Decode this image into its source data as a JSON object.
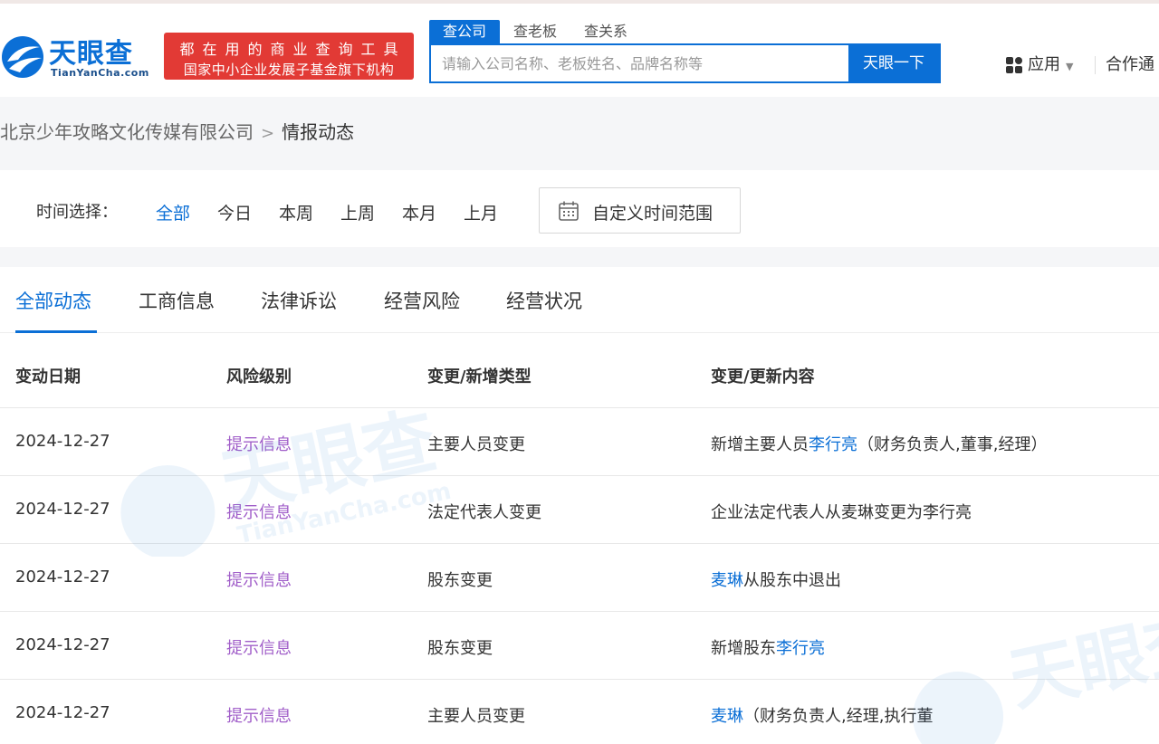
{
  "header": {
    "logo_cn": "天眼查",
    "logo_en": "TianYanCha.com",
    "slogan_line1": "都在用的商业查询工具",
    "slogan_line2": "国家中小企业发展子基金旗下机构",
    "search_tabs": [
      "查公司",
      "查老板",
      "查关系"
    ],
    "search_placeholder": "请输入公司名称、老板姓名、品牌名称等",
    "search_button": "天眼一下",
    "apps_label": "应用",
    "coop_label": "合作通"
  },
  "breadcrumb": {
    "company": "北京少年攻略文化传媒有限公司",
    "separator": ">",
    "current": "情报动态"
  },
  "filter": {
    "label": "时间选择：",
    "options": [
      "全部",
      "今日",
      "本周",
      "上周",
      "本月",
      "上月"
    ],
    "active": "全部",
    "custom_label": "自定义时间范围"
  },
  "tabs": {
    "items": [
      "全部动态",
      "工商信息",
      "法律诉讼",
      "经营风险",
      "经营状况"
    ],
    "active": "全部动态"
  },
  "table": {
    "headers": [
      "变动日期",
      "风险级别",
      "变更/新增类型",
      "变更/更新内容"
    ],
    "rows": [
      {
        "date": "2024-12-27",
        "risk": "提示信息",
        "type": "主要人员变更",
        "content_pre": "新增主要人员",
        "content_link": "李行亮",
        "content_post": "（财务负责人,董事,经理）"
      },
      {
        "date": "2024-12-27",
        "risk": "提示信息",
        "type": "法定代表人变更",
        "content_pre": "企业法定代表人从麦琳变更为李行亮",
        "content_link": "",
        "content_post": ""
      },
      {
        "date": "2024-12-27",
        "risk": "提示信息",
        "type": "股东变更",
        "content_pre": "",
        "content_link": "麦琳",
        "content_post": "从股东中退出"
      },
      {
        "date": "2024-12-27",
        "risk": "提示信息",
        "type": "股东变更",
        "content_pre": "新增股东",
        "content_link": "李行亮",
        "content_post": ""
      },
      {
        "date": "2024-12-27",
        "risk": "提示信息",
        "type": "主要人员变更",
        "content_pre": "",
        "content_link": "麦琳",
        "content_post": "（财务负责人,经理,执行董"
      }
    ]
  },
  "watermark": {
    "text_cn": "天眼查",
    "text_en": "TianYanCha.com"
  },
  "colors": {
    "brand_blue": "#0b6fd6",
    "risk_purple": "#a15fc9",
    "slogan_red": "#e23a35"
  }
}
